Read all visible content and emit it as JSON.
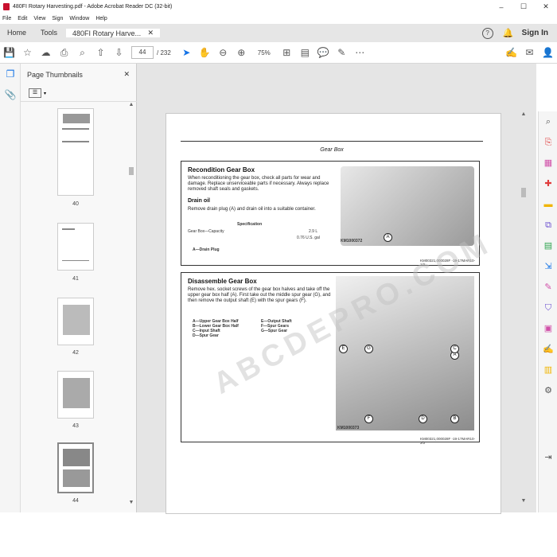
{
  "window": {
    "title": "480FI Rotary Harvesting.pdf - Adobe Acrobat Reader DC (32-bit)",
    "controls": [
      "–",
      "☐",
      "✕"
    ]
  },
  "menu": [
    "File",
    "Edit",
    "View",
    "Sign",
    "Window",
    "Help"
  ],
  "tabs": {
    "home": "Home",
    "tools": "Tools",
    "document": "480FI Rotary Harve...",
    "sign_in": "Sign In"
  },
  "toolbar": {
    "current_page": "44",
    "total_pages": "/ 232",
    "zoom": "75%"
  },
  "thumbnails": {
    "header": "Page Thumbnails",
    "pages": [
      "40",
      "41",
      "42",
      "43",
      "44"
    ],
    "selected": "44"
  },
  "document": {
    "section_header": "Gear Box",
    "recondition": {
      "title": "Recondition Gear Box",
      "text": "When reconditioning the gear box, check all parts for wear and damage. Replace unserviceable parts if necessary. Always replace removed shaft seals and gaskets.",
      "drain_title": "Drain oil",
      "drain_text": "Remove drain plug (A) and drain oil into a suitable container.",
      "spec_header": "Specification",
      "spec_label": "Gear Box—Capacity",
      "spec_value1": "2.9 L",
      "spec_value2": "0.76 U.S. gal",
      "legend": "A—Drain Plug",
      "photo_id": "KM1000372",
      "callout": "A",
      "footer": "KM00321,000028F -19-17MAR10-1/2",
      "side_code": "-UN-03AUG09"
    },
    "disassemble": {
      "title": "Disassemble Gear Box",
      "text": "Remove hex. socket screws of the gear box halves and take off the upper gear box half (A). First take out the middle spur gear (G), and then remove the output shaft (E) with the spur gears (F).",
      "legend_left": [
        "A—Upper Gear Box Half",
        "B—Lower Gear Box Half",
        "C—Input Shaft",
        "D—Spur Gear"
      ],
      "legend_right": [
        "E—Output Shaft",
        "F—Spur Gears",
        "G—Spur Gear"
      ],
      "photo_id": "KM1000373",
      "callouts": [
        "A",
        "E",
        "G",
        "C",
        "F",
        "D",
        "B"
      ],
      "footer": "KM00321,000028F -19-17MAR10-2/2",
      "side_code": "-UN-03AUG09"
    },
    "watermark": "ABCDEPRO.COM"
  }
}
